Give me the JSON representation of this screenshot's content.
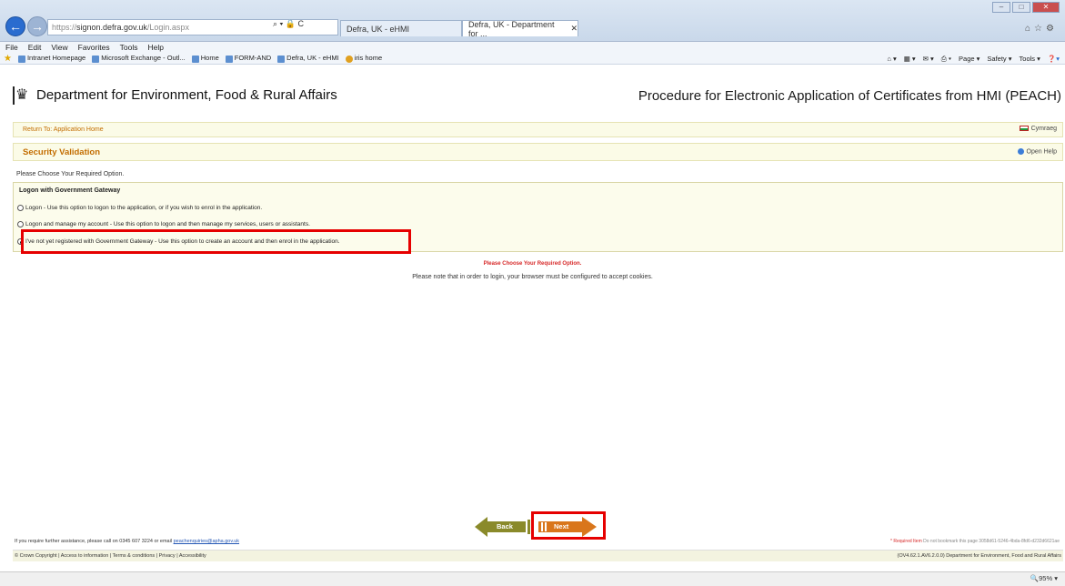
{
  "browser": {
    "url_prefix": "https://",
    "url_host": "signon.defra.gov.uk",
    "url_path": "/Login.aspx",
    "addr_tools": "⌕ ▾ 🔒 C",
    "tab1": "Defra, UK - eHMI",
    "tab2": "Defra, UK - Department for ...",
    "menu": [
      "File",
      "Edit",
      "View",
      "Favorites",
      "Tools",
      "Help"
    ],
    "favorites": [
      "Intranet Homepage",
      "Microsoft Exchange - Outl...",
      "Home",
      "FORM-AND",
      "Defra, UK - eHMI",
      "iris home"
    ],
    "commands": [
      "Page ▾",
      "Safety ▾",
      "Tools ▾"
    ],
    "zoom": "95%"
  },
  "header": {
    "org_name": "Department for Environment, Food & Rural Affairs",
    "app_name": "Procedure for Electronic Application of Certificates from HMI (PEACH)"
  },
  "nav": {
    "return_link": "Return To: Application Home",
    "cymraeg": "Cymraeg"
  },
  "section": {
    "title": "Security Validation",
    "open_help": "Open Help"
  },
  "form": {
    "prompt": "Please Choose Your Required Option.",
    "group_title": "Logon with Government Gateway",
    "options": [
      {
        "label": "Logon - Use this option to logon to the application, or if you wish to enrol in the application.",
        "checked": false
      },
      {
        "label": "Logon and manage my account - Use this option to logon and then manage my services, users or assistants.",
        "checked": false
      },
      {
        "label": "I've not yet registered with Government Gateway - Use this option to create an account and then enrol in the application.",
        "checked": true
      }
    ],
    "warning": "Please Choose Your Required Option.",
    "cookie_note": "Please note that in order to login, your browser must be configured to accept cookies."
  },
  "buttons": {
    "back": "Back",
    "next": "Next"
  },
  "footer": {
    "help_text": "If you require further assistance, please call on 0345 607 3224 or email",
    "help_email": "peachenquiries@apha.gov.uk",
    "required_note": "* Required Item",
    "bookmark_note": "Do not bookmark this page 3058d61-5246-4bda-8fd6-d232d6621ae",
    "links": "© Crown Copyright | Access to information | Terms & conditions | Privacy | Accessibility",
    "version": "(OV4.62.1.AV6.2.0.0) Department for Environment, Food and Rural Affairs"
  },
  "colors": {
    "accent_orange": "#c36d00",
    "highlight_red": "#e60000",
    "back_arrow": "#8a8a2a",
    "next_arrow": "#d9761c"
  }
}
